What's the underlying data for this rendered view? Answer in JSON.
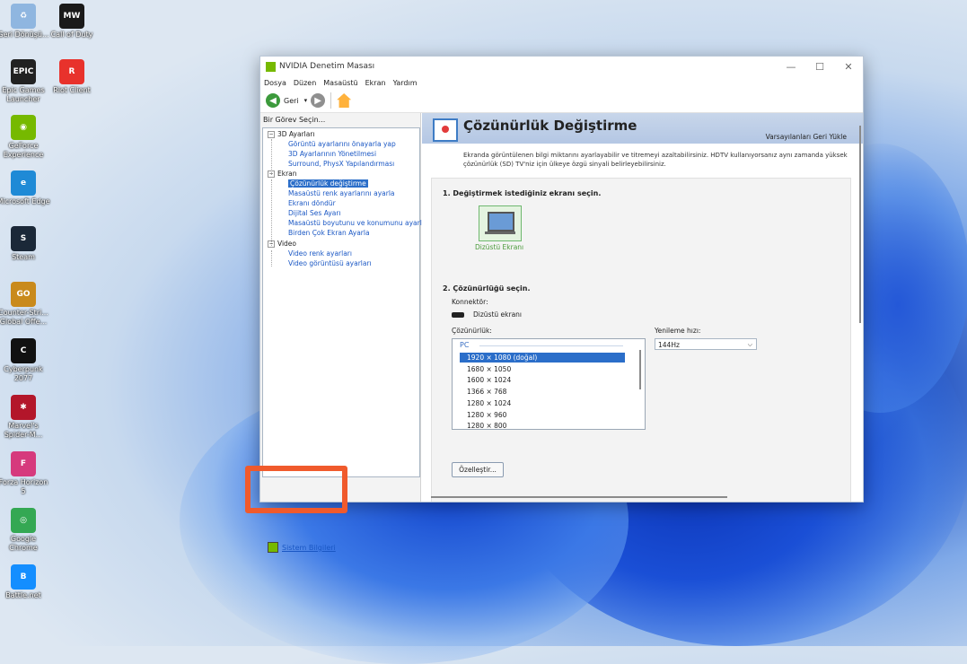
{
  "desktop": {
    "icons": [
      {
        "label": "Geri Dönüşü...",
        "color": "#8fb6e0",
        "glyph": "♻"
      },
      {
        "label": "Call of Duty",
        "color": "#1a1a1a",
        "glyph": "MW"
      },
      {
        "label": "Epic Games Launcher",
        "color": "#222222",
        "glyph": "EPIC"
      },
      {
        "label": "Riot Client",
        "color": "#e8322c",
        "glyph": "R"
      },
      {
        "label": "GeForce Experience",
        "color": "#76b900",
        "glyph": "◉"
      },
      {
        "label": "Microsoft Edge",
        "color": "#1f8ad6",
        "glyph": "e"
      },
      {
        "label": "Steam",
        "color": "#1b2838",
        "glyph": "S"
      },
      {
        "label": "Counter-Stri... Global Offe...",
        "color": "#c98a1c",
        "glyph": "GO"
      },
      {
        "label": "Cyberpunk 2077",
        "color": "#111111",
        "glyph": "C"
      },
      {
        "label": "Marvel's Spider-M...",
        "color": "#b3162a",
        "glyph": "✱"
      },
      {
        "label": "Forza Horizon 5",
        "color": "#d63a7d",
        "glyph": "F"
      },
      {
        "label": "Google Chrome",
        "color": "#34a853",
        "glyph": "◎"
      },
      {
        "label": "Battle.net",
        "color": "#148eff",
        "glyph": "B"
      }
    ]
  },
  "window": {
    "title": "NVIDIA Denetim Masası",
    "controls": {
      "minimize": "—",
      "maximize": "☐",
      "close": "✕"
    },
    "menu": [
      "Dosya",
      "Düzen",
      "Masaüstü",
      "Ekran",
      "Yardım"
    ],
    "toolbar": {
      "back_label": "Geri",
      "dropdown": "▾",
      "back_glyph": "◀",
      "forward_glyph": "▶"
    }
  },
  "left_panel": {
    "header": "Bir Görev Seçin...",
    "tree": {
      "cat_3d": "3D Ayarları",
      "item_3d_1": "Görüntü ayarlarını önayarla yap",
      "item_3d_2": "3D Ayarlarının Yönetilmesi",
      "item_3d_3": "Surround, PhysX Yapılandırması",
      "cat_ekran": "Ekran",
      "item_ekran_1": "Çözünürlük değiştirme",
      "item_ekran_2": "Masaüstü renk ayarlarını ayarla",
      "item_ekran_3": "Ekranı döndür",
      "item_ekran_4": "Dijital Ses Ayarı",
      "item_ekran_5": "Masaüstü boyutunu ve konumunu ayarla",
      "item_ekran_6": "Birden Çok Ekran Ayarla",
      "cat_video": "Video",
      "item_video_1": "Video renk ayarları",
      "item_video_2": "Video görüntüsü ayarları",
      "expander": "−"
    },
    "system_info": "Sistem Bilgileri"
  },
  "right_panel": {
    "title": "Çözünürlük Değiştirme",
    "restore": "Varsayılanları Geri Yükle",
    "description": "Ekranda görüntülenen bilgi miktarını ayarlayabilir ve titremeyi azaltabilirsiniz. HDTV kullanıyorsanız aynı zamanda yüksek çözünürlük (SD) TV'niz için ülkeye özgü sinyali belirleyebilirsiniz.",
    "step1": "1. Değiştirmek istediğiniz ekranı seçin.",
    "monitor_label": "Dizüstü Ekranı",
    "step2": "2. Çözünürlüğü seçin.",
    "connector_label": "Konnektör:",
    "connector_value": "Dizüstü ekranı",
    "resolution_label": "Çözünürlük:",
    "resolution_group": "PC",
    "resolutions": [
      "1920 × 1080 (doğal)",
      "1680 × 1050",
      "1600 × 1024",
      "1366 × 768",
      "1280 × 1024",
      "1280 × 960",
      "1280 × 800"
    ],
    "selected_resolution": "1920 × 1080 (doğal)",
    "refresh_label": "Yenileme hızı:",
    "refresh_value": "144Hz",
    "customize_button": "Özelleştir..."
  },
  "highlight_color": "#f05a2c"
}
